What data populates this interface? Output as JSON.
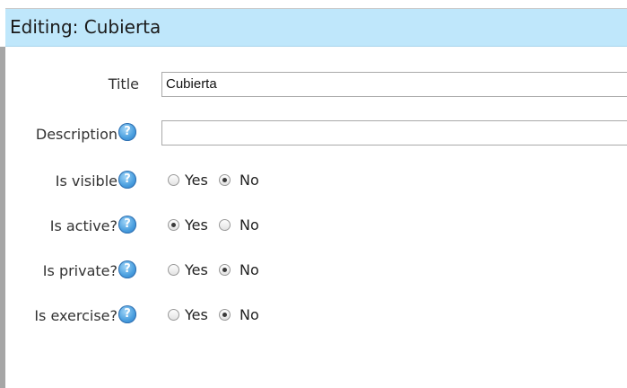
{
  "dialog": {
    "title": "Editing: Cubierta"
  },
  "form": {
    "title": {
      "label": "Title",
      "value": "Cubierta"
    },
    "description": {
      "label": "Description",
      "value": ""
    },
    "is_visible": {
      "label": "Is visible",
      "options": [
        "Yes",
        "No"
      ],
      "selected": "No"
    },
    "is_active": {
      "label": "Is active?",
      "options": [
        "Yes",
        "No"
      ],
      "selected": "Yes"
    },
    "is_private": {
      "label": "Is private?",
      "options": [
        "Yes",
        "No"
      ],
      "selected": "No"
    },
    "is_exercise": {
      "label": "Is exercise?",
      "options": [
        "Yes",
        "No"
      ],
      "selected": "No"
    }
  },
  "icons": {
    "help": "help-icon",
    "help_glyph": "?"
  },
  "colors": {
    "titlebar_bg": "#bfe7fb",
    "help_icon": "#4a9fdf"
  }
}
